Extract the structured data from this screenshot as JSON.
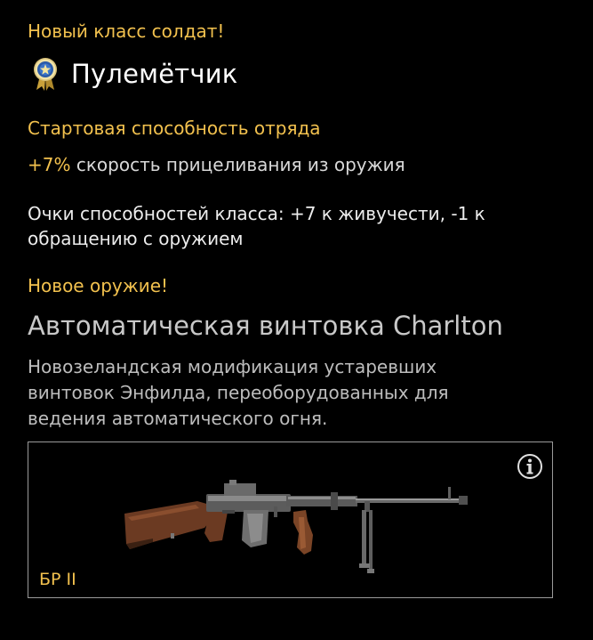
{
  "header": {
    "new_class_label": "Новый класс солдат!",
    "class_icon": "medal-icon",
    "class_name": "Пулемётчик"
  },
  "ability": {
    "title": "Стартовая способность отряда",
    "bonus_value": "+7%",
    "bonus_text": " скорость прицеливания из оружия"
  },
  "class_points": {
    "text": "Очки способностей класса: +7 к живучести, -1 к обращению с оружием"
  },
  "weapon": {
    "section_label": "Новое оружие!",
    "name": "Автоматическая винтовка Charlton",
    "description": "Новозеландская модификация устаревших винтовок Энфилда, переоборудованных для ведения автоматического огня.",
    "tier": "БР II",
    "image_icon": "rifle-image",
    "info_icon": "info-icon"
  },
  "colors": {
    "accent": "#f2c14e",
    "background": "#000000",
    "card_border": "#9a9a9a"
  }
}
